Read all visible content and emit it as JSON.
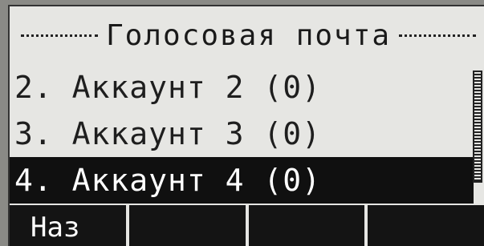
{
  "screen": {
    "title": "Голосовая почта",
    "items": [
      {
        "label": "2. Аккаунт 2 (0)",
        "selected": false
      },
      {
        "label": "3. Аккаунт 3 (0)",
        "selected": false
      },
      {
        "label": "4. Аккаунт 4 (0)",
        "selected": true
      }
    ],
    "softkeys": [
      "Наз",
      "",
      "",
      ""
    ]
  },
  "colors": {
    "screen_bg": "#e6e6e3",
    "text": "#1e1e1e",
    "selection_bg": "#101010",
    "selection_text": "#ffffff"
  }
}
